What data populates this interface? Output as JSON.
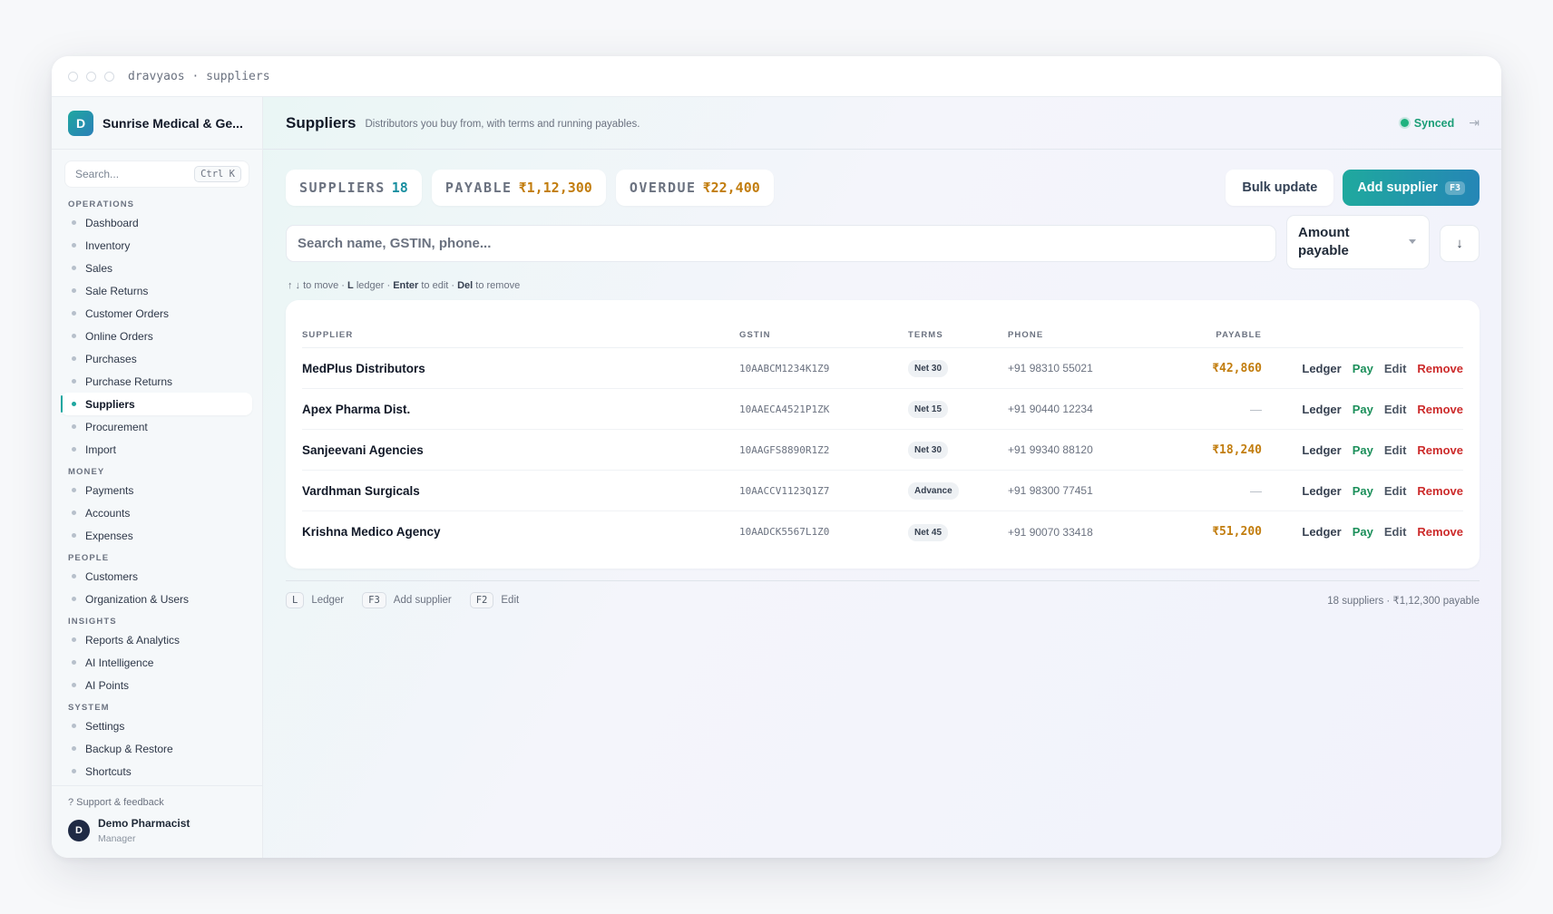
{
  "window": {
    "title": "dravyaos · suppliers"
  },
  "sidebar": {
    "org_initial": "D",
    "org_name": "Sunrise Medical & Ge...",
    "search_placeholder": "Search...",
    "search_shortcut": "Ctrl K",
    "sections": [
      {
        "title": "OPERATIONS",
        "items": [
          "Dashboard",
          "Inventory",
          "Sales",
          "Sale Returns",
          "Customer Orders",
          "Online Orders",
          "Purchases",
          "Purchase Returns",
          "Suppliers",
          "Procurement",
          "Import"
        ]
      },
      {
        "title": "MONEY",
        "items": [
          "Payments",
          "Accounts",
          "Expenses"
        ]
      },
      {
        "title": "PEOPLE",
        "items": [
          "Customers",
          "Organization & Users"
        ]
      },
      {
        "title": "INSIGHTS",
        "items": [
          "Reports & Analytics",
          "AI Intelligence",
          "AI Points"
        ]
      },
      {
        "title": "SYSTEM",
        "items": [
          "Settings",
          "Backup & Restore",
          "Shortcuts"
        ]
      }
    ],
    "active_item": "Suppliers",
    "support_label": "? Support & feedback",
    "user": {
      "initial": "D",
      "name": "Demo Pharmacist",
      "role": "Manager"
    }
  },
  "header": {
    "title": "Suppliers",
    "subtitle": "Distributors you buy from, with terms and running payables.",
    "sync_status": "Synced"
  },
  "stats": [
    {
      "label": "SUPPLIERS",
      "value": "18",
      "color": "#1a8fa0"
    },
    {
      "label": "PAYABLE",
      "value": "₹1,12,300",
      "color": "#c27d0e"
    },
    {
      "label": "OVERDUE",
      "value": "₹22,400",
      "color": "#c27d0e"
    }
  ],
  "actions": {
    "bulk_update": "Bulk update",
    "add_supplier": "Add supplier",
    "add_shortcut": "F3"
  },
  "search": {
    "placeholder": "Search name, GSTIN, phone...",
    "sort_label": "Amount payable",
    "sort_dir": "↓"
  },
  "hint": {
    "arrows": "↑ ↓",
    "move": " to move · ",
    "l": "L",
    "ledger": " ledger · ",
    "enter": "Enter",
    "edit": " to edit · ",
    "del": "Del",
    "remove": " to remove"
  },
  "table": {
    "columns": {
      "supplier": "SUPPLIER",
      "gstin": "GSTIN",
      "terms": "TERMS",
      "phone": "PHONE",
      "payable": "PAYABLE"
    },
    "row_actions": {
      "ledger": "Ledger",
      "pay": "Pay",
      "edit": "Edit",
      "remove": "Remove"
    },
    "rows": [
      {
        "name": "MedPlus Distributors",
        "gstin": "10AABCM1234K1Z9",
        "terms": "Net 30",
        "phone": "+91 98310 55021",
        "payable": "₹42,860"
      },
      {
        "name": "Apex Pharma Dist.",
        "gstin": "10AAECA4521P1ZK",
        "terms": "Net 15",
        "phone": "+91 90440 12234",
        "payable": "—"
      },
      {
        "name": "Sanjeevani Agencies",
        "gstin": "10AAGFS8890R1Z2",
        "terms": "Net 30",
        "phone": "+91 99340 88120",
        "payable": "₹18,240"
      },
      {
        "name": "Vardhman Surgicals",
        "gstin": "10AACCV1123Q1Z7",
        "terms": "Advance",
        "phone": "+91 98300 77451",
        "payable": "—"
      },
      {
        "name": "Krishna Medico Agency",
        "gstin": "10AADCK5567L1Z0",
        "terms": "Net 45",
        "phone": "+91 90070 33418",
        "payable": "₹51,200"
      }
    ]
  },
  "footer": {
    "shortcuts": [
      {
        "key": "L",
        "label": "Ledger"
      },
      {
        "key": "F3",
        "label": "Add supplier"
      },
      {
        "key": "F2",
        "label": "Edit"
      }
    ],
    "summary": "18 suppliers · ₹1,12,300 payable"
  }
}
